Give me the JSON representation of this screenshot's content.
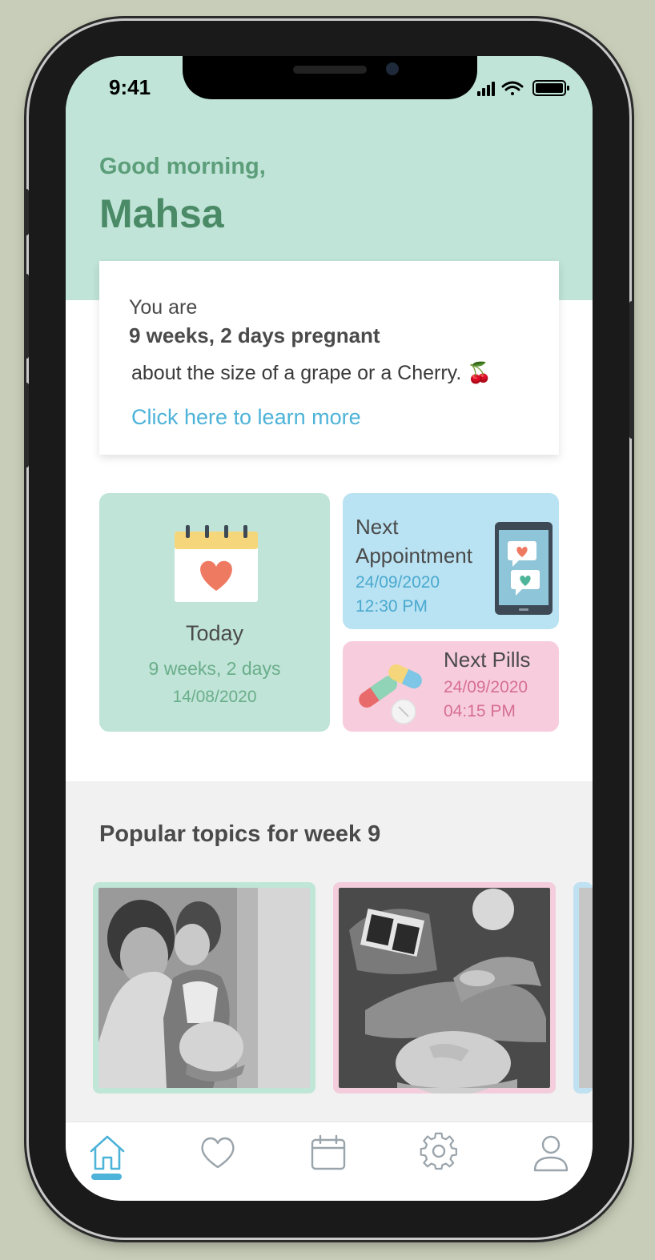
{
  "status_bar": {
    "time": "9:41"
  },
  "header": {
    "greeting": "Good morning,",
    "name": "Mahsa"
  },
  "pregnancy_card": {
    "intro": "You are",
    "progress": "9 weeks, 2 days pregnant",
    "size_text": "about the size of a grape or a Cherry. 🍒",
    "learn_more": "Click here to learn more"
  },
  "today_card": {
    "label": "Today",
    "weeks": "9 weeks, 2 days",
    "date": "14/08/2020",
    "icon": "calendar-heart-icon"
  },
  "appointment_card": {
    "title": "Next Appointment",
    "date": "24/09/2020",
    "time": "12:30 PM",
    "icon": "phone-chat-icon"
  },
  "pills_card": {
    "title": "Next Pills",
    "date": "24/09/2020",
    "time": "04:15 PM",
    "icon": "pills-icon"
  },
  "topics": {
    "title": "Popular topics for week 9"
  },
  "tabbar": {
    "items": [
      "home-icon",
      "heart-icon",
      "calendar-icon",
      "gear-icon",
      "user-icon"
    ],
    "active": "home-icon"
  },
  "colors": {
    "mint": "#c0e4d8",
    "green_text": "#4a8a66",
    "blue_accent": "#4db3d8",
    "light_blue": "#b9e2f2",
    "pink": "#f7cddd",
    "pink_text": "#d66e93"
  }
}
